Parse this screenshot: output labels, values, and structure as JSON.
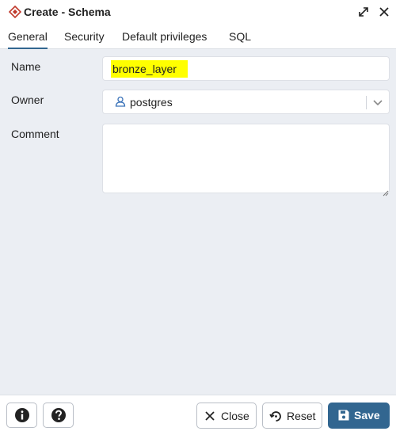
{
  "window": {
    "title": "Create - Schema",
    "icon": "schema-icon",
    "controls": [
      "maximize-icon",
      "close-icon"
    ]
  },
  "tabs": [
    {
      "label": "General",
      "active": true
    },
    {
      "label": "Security",
      "active": false
    },
    {
      "label": "Default privileges",
      "active": false
    },
    {
      "label": "SQL",
      "active": false
    }
  ],
  "form": {
    "name": {
      "label": "Name",
      "value": "bronze_layer",
      "highlight_color": "#ffff00"
    },
    "owner": {
      "label": "Owner",
      "value": "postgres",
      "icon": "user-role-icon"
    },
    "comment": {
      "label": "Comment",
      "value": ""
    }
  },
  "footer": {
    "info_icon": "info-icon",
    "help_icon": "help-icon",
    "close_label": "Close",
    "reset_label": "Reset",
    "save_label": "Save"
  },
  "colors": {
    "accent": "#326690",
    "background": "#ebeef3",
    "schema_icon": "#c0392b"
  }
}
